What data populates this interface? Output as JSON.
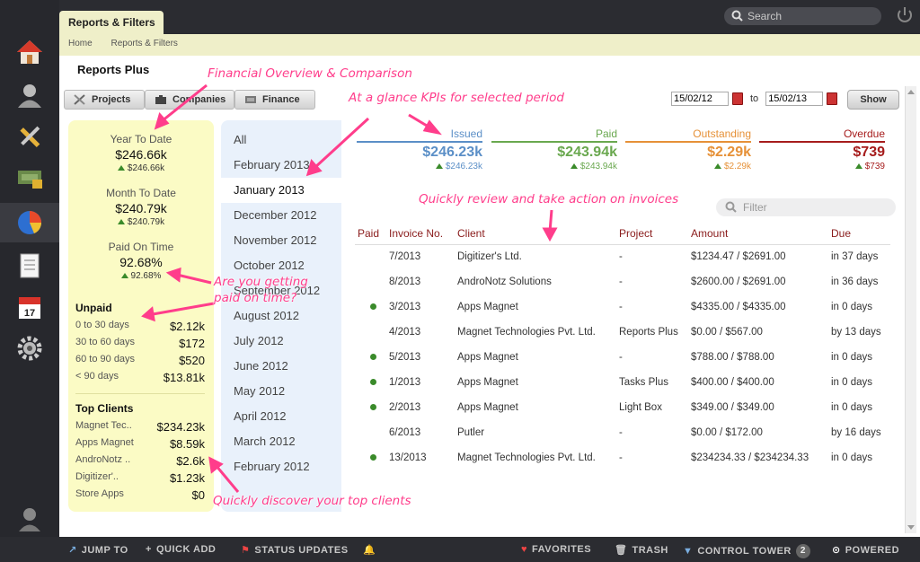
{
  "app": {
    "tab_label": "Reports & Filters",
    "page_title": "Reports Plus"
  },
  "search": {
    "placeholder": "Search"
  },
  "breadcrumb": [
    "Home",
    "Reports & Filters"
  ],
  "subtabs": [
    "Projects",
    "Companies",
    "Finance"
  ],
  "date_range": {
    "from": "15/02/12",
    "to_label": "to",
    "to": "15/02/13",
    "show_label": "Show"
  },
  "summary": {
    "ytd": {
      "label": "Year To Date",
      "value": "$246.66k",
      "delta": "$246.66k"
    },
    "mtd": {
      "label": "Month To Date",
      "value": "$240.79k",
      "delta": "$240.79k"
    },
    "pot": {
      "label": "Paid On Time",
      "value": "92.68%",
      "delta": "92.68%"
    },
    "unpaid_title": "Unpaid",
    "unpaid": [
      {
        "label": "0 to 30 days",
        "value": "$2.12k"
      },
      {
        "label": "30 to 60 days",
        "value": "$172"
      },
      {
        "label": "60 to 90 days",
        "value": "$520"
      },
      {
        "label": "< 90 days",
        "value": "$13.81k"
      }
    ],
    "clients_title": "Top Clients",
    "clients": [
      {
        "label": "Magnet Tec..",
        "value": "$234.23k"
      },
      {
        "label": "Apps Magnet",
        "value": "$8.59k"
      },
      {
        "label": "AndroNotz ..",
        "value": "$2.6k"
      },
      {
        "label": "Digitizer'..",
        "value": "$1.23k"
      },
      {
        "label": "Store Apps",
        "value": "$0"
      }
    ]
  },
  "periods": [
    "All",
    "February 2013",
    "January 2013",
    "December 2012",
    "November 2012",
    "October 2012",
    "September 2012",
    "August 2012",
    "July 2012",
    "June 2012",
    "May 2012",
    "April 2012",
    "March 2012",
    "February 2012"
  ],
  "selected_period": "January 2013",
  "kpis": [
    {
      "name": "Issued",
      "value": "$246.23k",
      "delta": "$246.23k",
      "color": "#5b8fc7"
    },
    {
      "name": "Paid",
      "value": "$243.94k",
      "delta": "$243.94k",
      "color": "#6aa84f"
    },
    {
      "name": "Outstanding",
      "value": "$2.29k",
      "delta": "$2.29k",
      "color": "#e69138"
    },
    {
      "name": "Overdue",
      "value": "$739",
      "delta": "$739",
      "color": "#a61c1c"
    }
  ],
  "filter": {
    "placeholder": "Filter"
  },
  "table": {
    "headers": [
      "Paid",
      "Invoice No.",
      "Client",
      "Project",
      "Amount",
      "Due"
    ],
    "rows": [
      {
        "paid": false,
        "no": "7/2013",
        "client": "Digitizer's Ltd.",
        "project": "-",
        "amount": "$1234.47 / $2691.00",
        "due": "in 37 days",
        "late": false
      },
      {
        "paid": false,
        "no": "8/2013",
        "client": "AndroNotz Solutions",
        "project": "-",
        "amount": "$2600.00 / $2691.00",
        "due": "in 36 days",
        "late": false
      },
      {
        "paid": true,
        "no": "3/2013",
        "client": "Apps Magnet",
        "project": "-",
        "amount": "$4335.00 / $4335.00",
        "due": "in 0 days",
        "late": false
      },
      {
        "paid": false,
        "no": "4/2013",
        "client": "Magnet Technologies Pvt. Ltd.",
        "project": "Reports Plus",
        "amount": "$0.00 / $567.00",
        "due": "by 13 days",
        "late": true
      },
      {
        "paid": true,
        "no": "5/2013",
        "client": "Apps Magnet",
        "project": "-",
        "amount": "$788.00 / $788.00",
        "due": "in 0 days",
        "late": false
      },
      {
        "paid": true,
        "no": "1/2013",
        "client": "Apps Magnet",
        "project": "Tasks Plus",
        "amount": "$400.00 / $400.00",
        "due": "in 0 days",
        "late": false
      },
      {
        "paid": true,
        "no": "2/2013",
        "client": "Apps Magnet",
        "project": "Light Box",
        "amount": "$349.00 / $349.00",
        "due": "in 0 days",
        "late": false
      },
      {
        "paid": false,
        "no": "6/2013",
        "client": "Putler",
        "project": "-",
        "amount": "$0.00 / $172.00",
        "due": "by 16 days",
        "late": true
      },
      {
        "paid": true,
        "no": "13/2013",
        "client": "Magnet Technologies Pvt. Ltd.",
        "project": "-",
        "amount": "$234234.33 / $234234.33",
        "due": "in 0 days",
        "late": false
      }
    ]
  },
  "annotations": {
    "financial": "Financial Overview & Comparison",
    "kpis": "At a glance KPIs for selected period",
    "invoices": "Quickly review and take action on invoices",
    "paid_on_time_1": "Are you getting",
    "paid_on_time_2": "paid on time?",
    "clients": "Quickly discover your top clients"
  },
  "bottombar": {
    "jump_to": "JUMP TO",
    "quick_add": "QUICK ADD",
    "status_updates": "STATUS UPDATES",
    "favorites": "FAVORITES",
    "trash": "TRASH",
    "control_tower": "CONTROL TOWER",
    "control_tower_count": "2",
    "powered": "POWERED"
  }
}
